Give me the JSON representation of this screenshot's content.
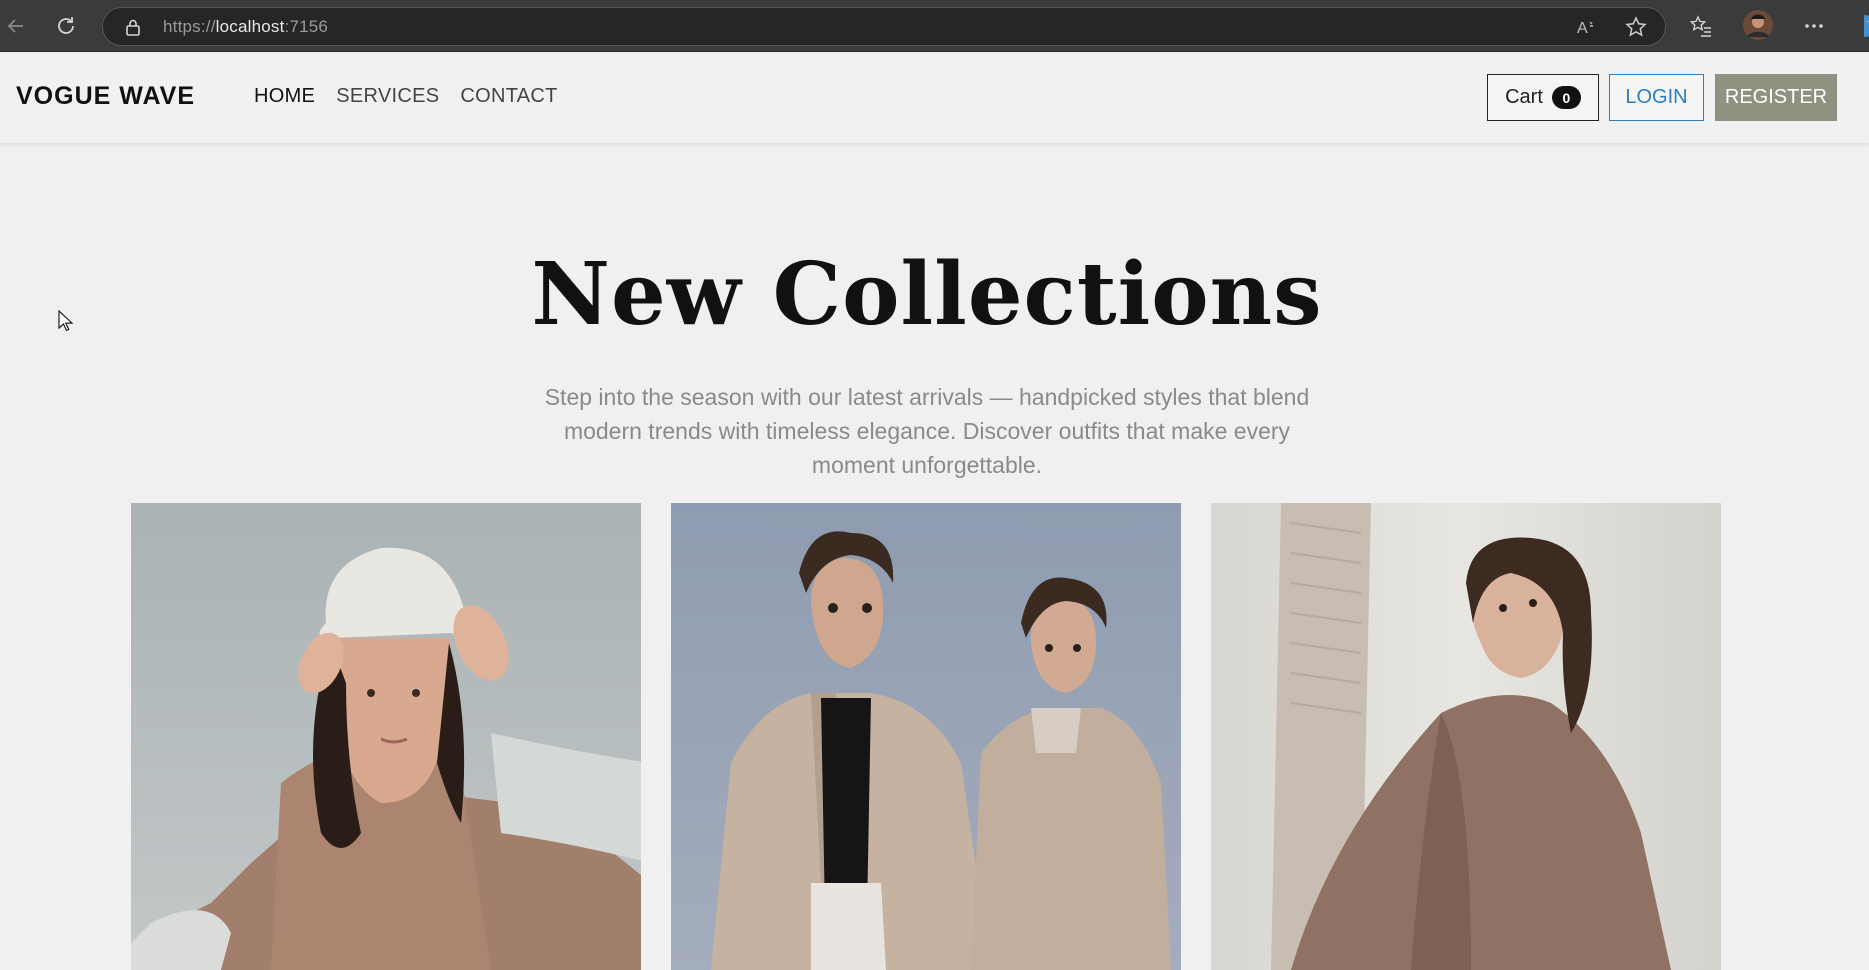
{
  "browser": {
    "url_scheme": "https://",
    "url_host": "localhost",
    "url_port": ":7156"
  },
  "nav": {
    "brand": "VOGUE WAVE",
    "links": [
      "HOME",
      "SERVICES",
      "CONTACT"
    ],
    "cart_label": "Cart",
    "cart_count": "0",
    "login_label": "LOGIN",
    "register_label": "REGISTER"
  },
  "hero": {
    "title": "New Collections",
    "subtitle": "Step into the season with our latest arrivals — handpicked styles that blend modern trends with timeless elegance. Discover outfits that make every moment unforgettable."
  },
  "gallery": {
    "images": [
      "model-bucket-hat-photo",
      "two-models-trench-coats-photo",
      "model-plaid-blazer-photo"
    ]
  },
  "colors": {
    "register_bg": "#8f9181",
    "login_accent": "#2a7fc3",
    "page_bg": "#f0f0f0"
  }
}
